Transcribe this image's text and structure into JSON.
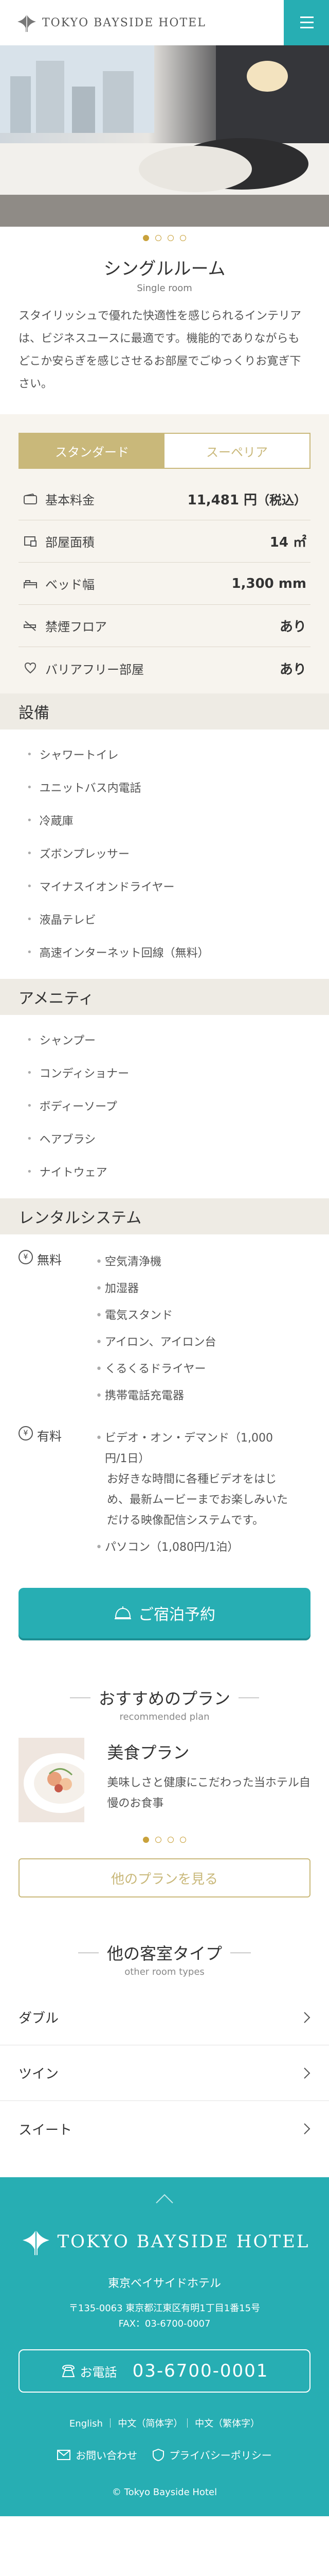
{
  "header": {
    "brand": "TOKYO BAYSIDE HOTEL",
    "menu_icon": "hamburger-icon"
  },
  "hero": {
    "slides": 4,
    "active_slide": 1
  },
  "room": {
    "title": "シングルルーム",
    "subtitle": "Single room",
    "description": "スタイリッシュで優れた快適性を感じられるインテリアは、ビジネスユースに最適です。機能的でありながらもどこか安らぎを感じさせるお部屋でごゆっくりお寛ぎ下さい。"
  },
  "toggle": {
    "standard": "スタンダード",
    "superior": "スーペリア",
    "selected": "スタンダード"
  },
  "specs": [
    {
      "label": "基本料金",
      "value": "11,481 円",
      "extra": "（税込）",
      "icon": "wallet-icon"
    },
    {
      "label": "部屋面積",
      "value": "14 ㎡",
      "extra": "",
      "icon": "room-icon"
    },
    {
      "label": "ベッド幅",
      "value": "1,300 mm",
      "extra": "",
      "icon": "bed-icon"
    },
    {
      "label": "禁煙フロア",
      "value": "あり",
      "extra": "",
      "icon": "no-smoking-icon"
    },
    {
      "label": "バリアフリー部屋",
      "value": "あり",
      "extra": "",
      "icon": "heart-icon"
    }
  ],
  "facilities": {
    "title": "設備",
    "items": [
      "シャワートイレ",
      "ユニットバス内電話",
      "冷蔵庫",
      "ズボンプレッサー",
      "マイナスイオンドライヤー",
      "液晶テレビ",
      "高速インターネット回線（無料）"
    ]
  },
  "amenities": {
    "title": "アメニティ",
    "items": [
      "シャンプー",
      "コンディショナー",
      "ボディーソープ",
      "ヘアブラシ",
      "ナイトウェア"
    ]
  },
  "rental": {
    "title": "レンタルシステム",
    "free_label": "無料",
    "free_items": [
      "空気清浄機",
      "加湿器",
      "電気スタンド",
      "アイロン、アイロン台",
      "くるくるドライヤー",
      "携帯電話充電器"
    ],
    "paid_label": "有料",
    "paid_item1": "ビデオ・オン・デマンド（1,000円/1日）",
    "paid_item1_note": "お好きな時間に各種ビデオをはじめ、最新ムービーまでお楽しみいただける映像配信システムです。",
    "paid_item2": "パソコン（1,080円/1泊）"
  },
  "reserve": {
    "label": "ご宿泊予約"
  },
  "plans": {
    "title": "おすすめのプラン",
    "subtitle": "recommended plan",
    "card_name": "美食プラン",
    "card_desc": "美味しさと健康にこだわった当ホテル自慢のお食事",
    "more": "他のプランを見る",
    "slides": 4,
    "active_slide": 1
  },
  "other_rooms": {
    "title": "他の客室タイプ",
    "subtitle": "other room types",
    "items": [
      "ダブル",
      "ツイン",
      "スイート"
    ]
  },
  "footer": {
    "brand": "TOKYO BAYSIDE HOTEL",
    "name": "東京ベイサイドホテル",
    "address": "〒135-0063 東京都江東区有明1丁目1番15号",
    "fax": "FAX：03-6700-0007",
    "tel_label": "お電話",
    "tel": "03-6700-0001",
    "langs": "English ｜ 中文（简体字）｜ 中文（繁体字）",
    "contact": "お問い合わせ",
    "privacy": "プライバシーポリシー",
    "copyright": "© Tokyo Bayside Hotel"
  },
  "colors": {
    "accent": "#27aeb3",
    "gold": "#c9b87a",
    "beige": "#f7f4ee"
  }
}
